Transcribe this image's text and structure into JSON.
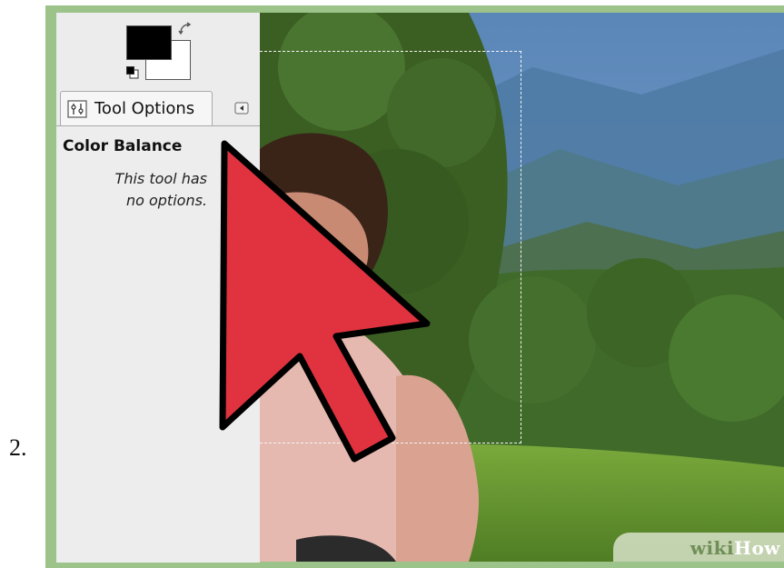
{
  "step": {
    "number": "2."
  },
  "tool_options": {
    "tab_label": "Tool Options",
    "tab_icon": "tool-options-icon",
    "menu_icon": "tab-menu-icon",
    "tool_name": "Color Balance",
    "message_line1": "This tool has",
    "message_line2": "no options."
  },
  "color_widget": {
    "foreground": "#000000",
    "background": "#ffffff",
    "swap_icon": "swap-colors-icon",
    "reset_icon": "default-colors-icon"
  },
  "watermark": {
    "part1": "wiki",
    "part2": "How"
  },
  "colors": {
    "frame": "#9cc38a",
    "arrow_fill": "#e0333f",
    "arrow_stroke": "#000000"
  }
}
